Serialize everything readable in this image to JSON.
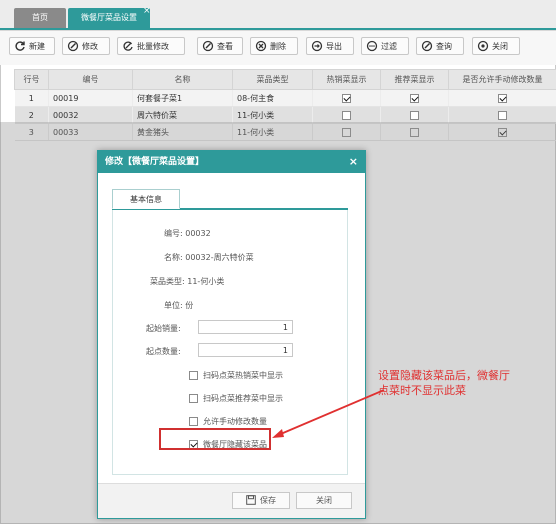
{
  "tabs": {
    "home": "首页",
    "active": "微餐厅菜品设置",
    "close": "×"
  },
  "toolbar": [
    {
      "label": "新建",
      "icon": "refresh-icon"
    },
    {
      "label": "修改",
      "icon": "edit-icon"
    },
    {
      "label": "批量修改",
      "icon": "batch-edit-icon"
    },
    {
      "label": "查看",
      "icon": "view-icon"
    },
    {
      "label": "删除",
      "icon": "delete-icon"
    },
    {
      "label": "导出",
      "icon": "export-icon"
    },
    {
      "label": "过滤",
      "icon": "filter-icon"
    },
    {
      "label": "查询",
      "icon": "query-icon"
    },
    {
      "label": "关闭",
      "icon": "close-icon"
    }
  ],
  "grid": {
    "columns": [
      "行号",
      "编号",
      "名称",
      "菜品类型",
      "热销菜显示",
      "推荐菜显示",
      "是否允许手动修改数量"
    ],
    "rows": [
      {
        "row": "1",
        "code": "00019",
        "name": "何套餐子菜1",
        "type": "08-何主食",
        "hot": true,
        "rec": true,
        "manual": true
      },
      {
        "row": "2",
        "code": "00032",
        "name": "周六特价菜",
        "type": "11-何小类",
        "hot": false,
        "rec": false,
        "manual": false
      },
      {
        "row": "3",
        "code": "00033",
        "name": "黄金猪头",
        "type": "11-何小类",
        "hot": false,
        "rec": false,
        "manual": true
      }
    ]
  },
  "dialog": {
    "title": "修改【微餐厅菜品设置】",
    "close": "×",
    "tab": "基本信息",
    "code_label": "编号:",
    "code": "00032",
    "name_label": "名称:",
    "name": "00032-周六特价菜",
    "type_label": "菜品类型:",
    "type": "11-何小类",
    "unit_label": "单位:",
    "unit": "份",
    "min_sale_label": "起始销量:",
    "min_sale": "1",
    "start_qty_label": "起点数量:",
    "start_qty": "1",
    "checks": [
      {
        "label": "扫码点菜热销菜中显示",
        "checked": false
      },
      {
        "label": "扫码点菜推荐菜中显示",
        "checked": false
      },
      {
        "label": "允许手动修改数量",
        "checked": false
      },
      {
        "label": "微餐厅隐藏该菜品",
        "checked": true
      }
    ],
    "save": "保存",
    "close_btn": "关闭"
  },
  "annotation": {
    "line1": "设置隐藏该菜品后，微餐厅",
    "line2": "点菜时不显示此菜",
    "color": "#e03030"
  },
  "colors": {
    "accent": "#2e9a9a",
    "highlight": "#d03030"
  }
}
